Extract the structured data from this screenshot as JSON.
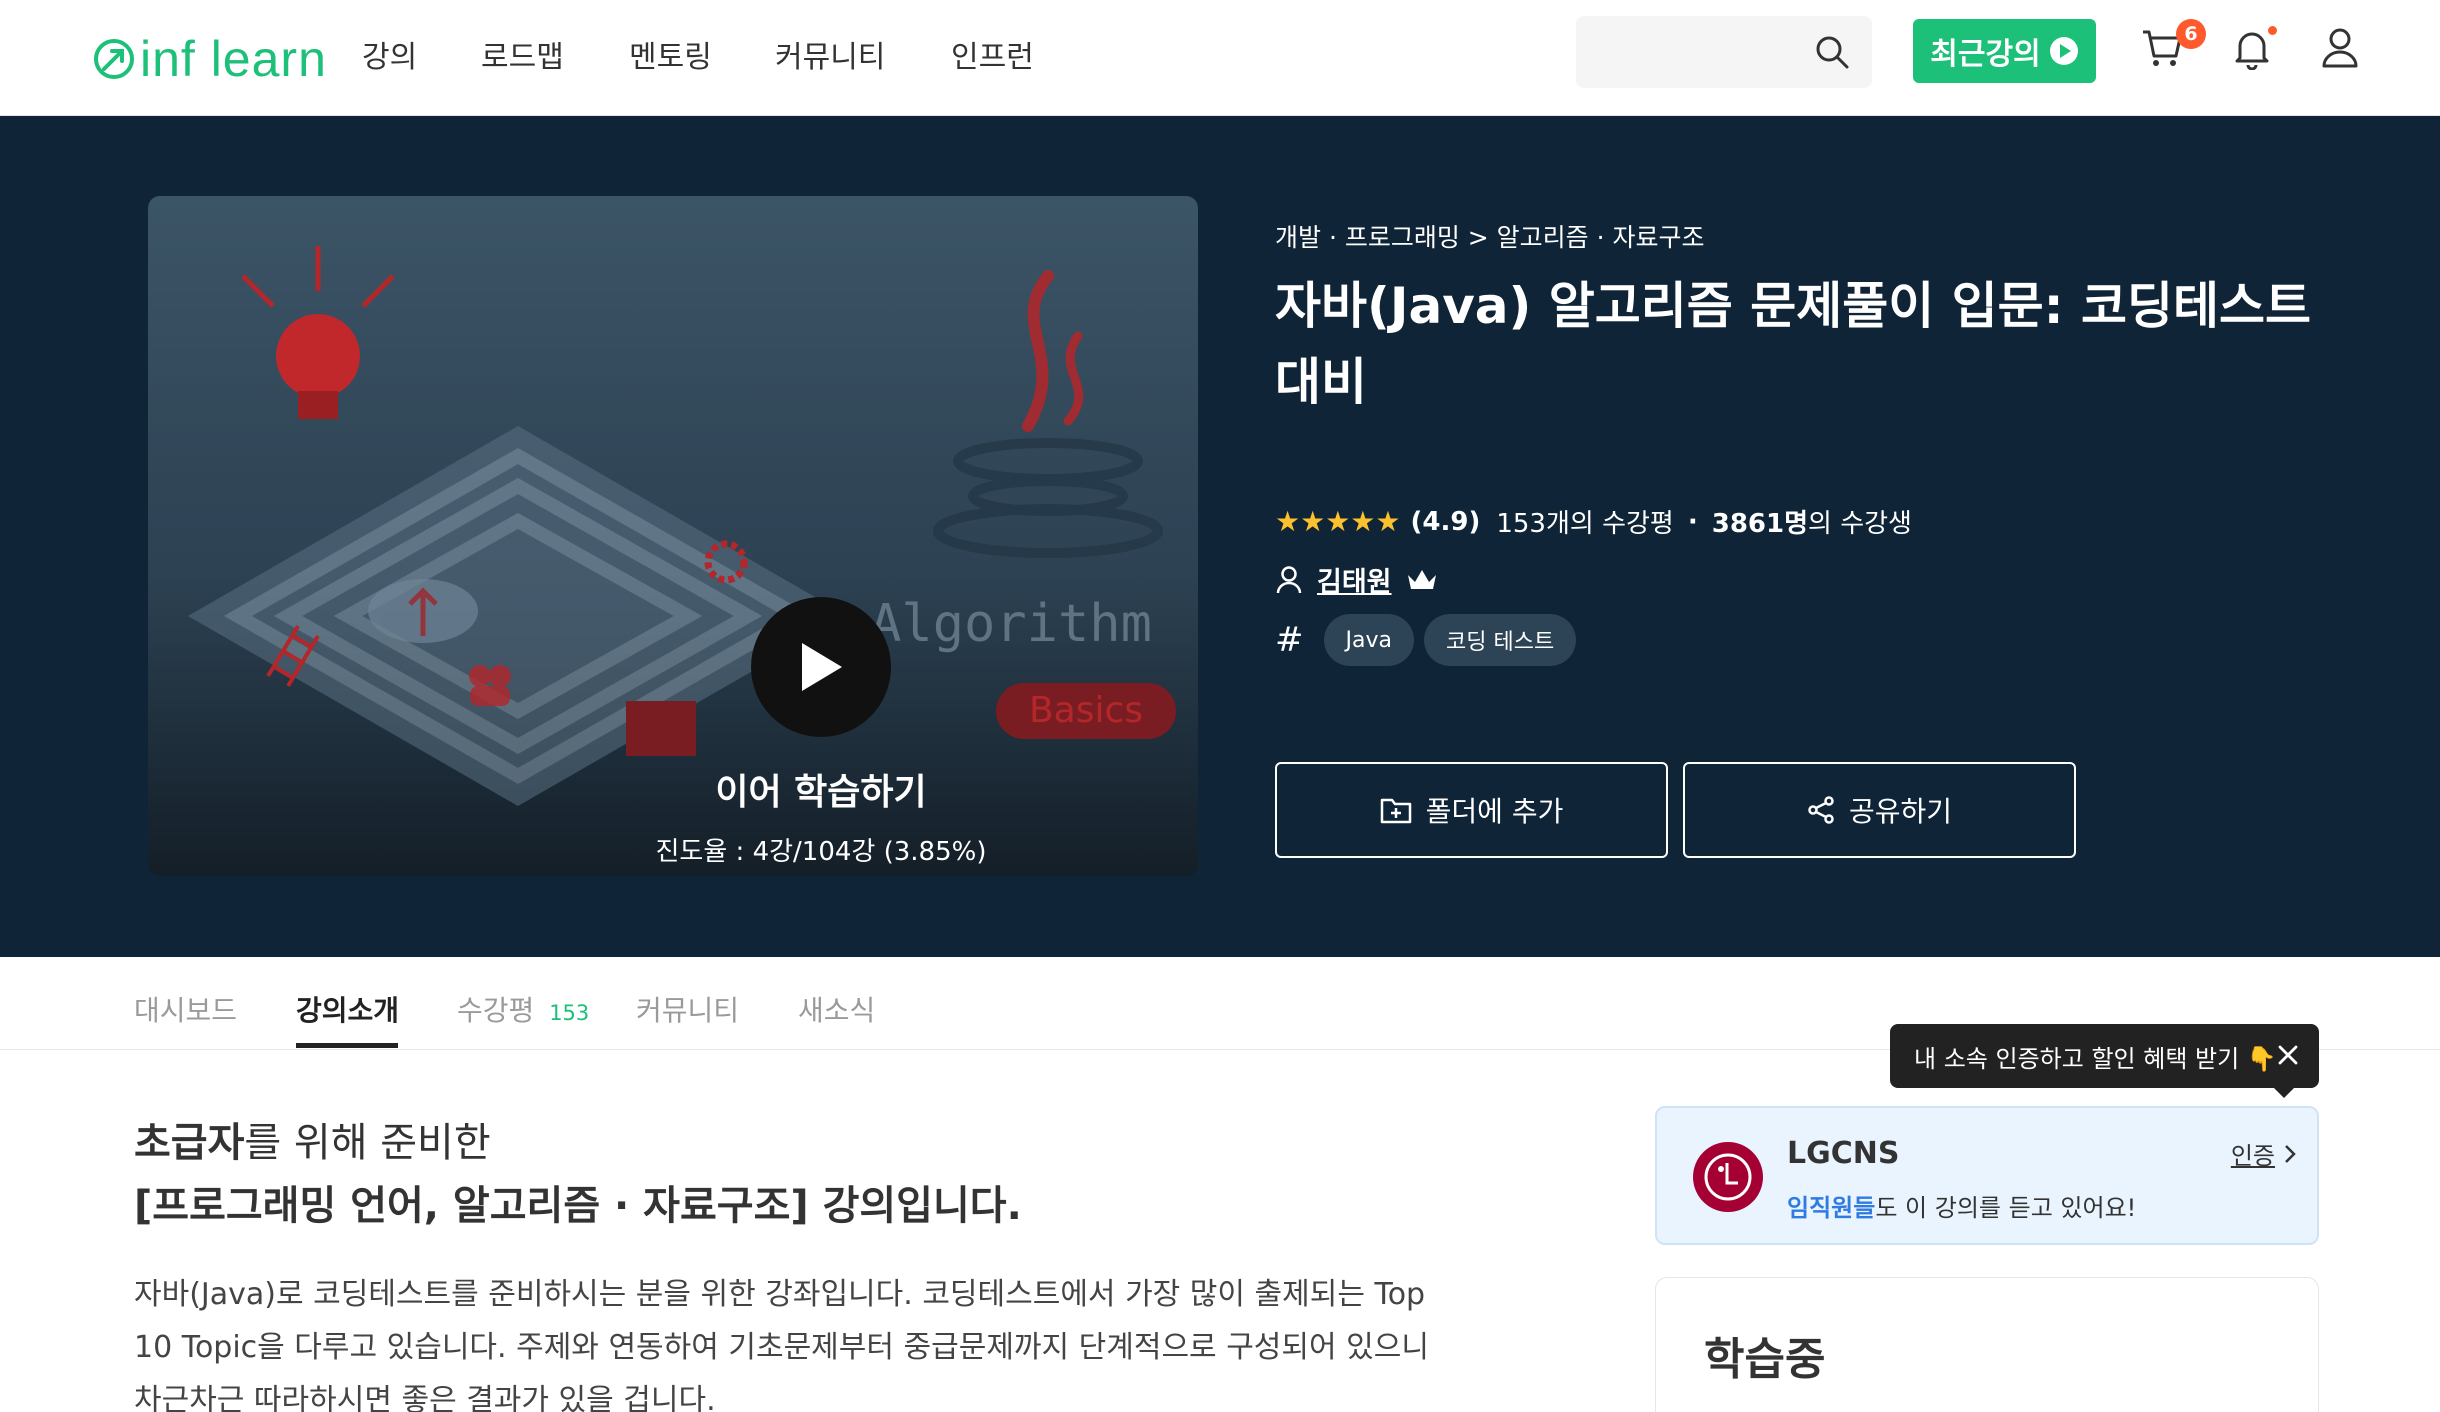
{
  "header": {
    "logo_text": "inf learn",
    "nav": [
      "강의",
      "로드맵",
      "멘토링",
      "커뮤니티",
      "인프런"
    ],
    "search_placeholder": "",
    "recent_button": "최근강의",
    "cart_count": "6"
  },
  "colors": {
    "brand": "#1dc078",
    "hero_bg": "#0f2436",
    "badge": "#ff5a2d",
    "star": "#fdc02f"
  },
  "hero": {
    "thumbnail": {
      "continue_label": "이어 학습하기",
      "progress_text": "진도율 : 4강/104강 (3.85%)",
      "progress_fraction": 0.0385,
      "art_text": "Algorithm",
      "art_badge": "Basics"
    },
    "breadcrumb": "개발 · 프로그래밍 > 알고리즘 · 자료구조",
    "title": "자바(Java) 알고리즘 문제풀이 입문: 코딩테스트 대비",
    "rating": "(4.9)",
    "stars": 5,
    "review_count_text": "153개의 수강평",
    "separator": "·",
    "students_bold": "3861명",
    "students_suffix": "의 수강생",
    "instructor": "김태원",
    "hash_symbol": "#",
    "tags": [
      "Java",
      "코딩 테스트"
    ],
    "add_folder_button": "폴더에 추가",
    "share_button": "공유하기"
  },
  "tabs": {
    "items": [
      "대시보드",
      "강의소개",
      "수강평",
      "커뮤니티",
      "새소식"
    ],
    "review_count": "153",
    "active": "강의소개"
  },
  "intro": {
    "line1_bold": "초급자",
    "line1_rest": "를 위해 준비한",
    "line2": "[프로그래밍 언어, 알고리즘 · 자료구조] 강의입니다.",
    "description": "자바(Java)로 코딩테스트를 준비하시는 분을 위한 강좌입니다. 코딩테스트에서 가장 많이 출제되는 Top 10 Topic을 다루고 있습니다. 주제와 연동하여 기초문제부터 중급문제까지 단계적으로 구성되어 있으니 차근차근 따라하시면 좋은 결과가 있을 겁니다."
  },
  "sidebar": {
    "tooltip": "내 소속 인증하고 할인 혜택 받기 👇",
    "company_name": "LGCNS",
    "company_sub_highlight": "임직원들",
    "company_sub_rest": "도 이 강의를 듣고 있어요!",
    "verify_link": "인증",
    "learning_title": "학습중"
  }
}
